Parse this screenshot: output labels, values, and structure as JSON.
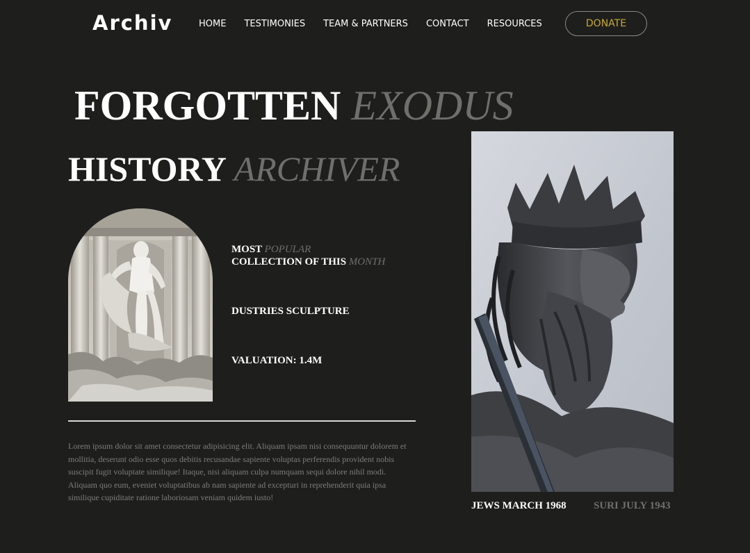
{
  "header": {
    "logo": "Archiv",
    "nav": [
      "HOME",
      "TESTIMONIES",
      "TEAM & PARTNERS",
      "CONTACT",
      "RESOURCES"
    ],
    "donate_label": "DONATE"
  },
  "hero": {
    "title_1a": "FORGOTTEN",
    "title_1b": "EXODUS",
    "title_2a": "HISTORY",
    "title_2b": "ARCHIVER"
  },
  "feature": {
    "line1a": "MOST",
    "line1b": "POPULAR",
    "line2a": "COLLECTION OF THIS",
    "line2b": "MONTH",
    "name": "DUSTRIES SCULPTURE",
    "valuation": "VALUATION: 1.4M"
  },
  "body_text": "Lorem ipsum dolor sit amet consectetur adipisicing elit. Aliquam ipsam nisi consequuntur dolorem et mollitia, deserunt odio esse quos debitis recusandae sapiente voluptas perferendis provident nobis suscipit fugit voluptate similique! Itaque, nisi aliquam culpa numquam sequi dolore nihil modi. Aliquam quo eum, eveniet voluptatibus ab nam sapiente ad excepturi in reprehenderit quia ipsa similique cupiditate ratione laboriosam veniam quidem iusto!",
  "captions": {
    "left": "JEWS MARCH 1968",
    "right": "SURI JULY 1943"
  },
  "colors": {
    "background": "#1e1f1d",
    "accent_gold": "#c9a834",
    "muted": "#6f6f6b"
  }
}
